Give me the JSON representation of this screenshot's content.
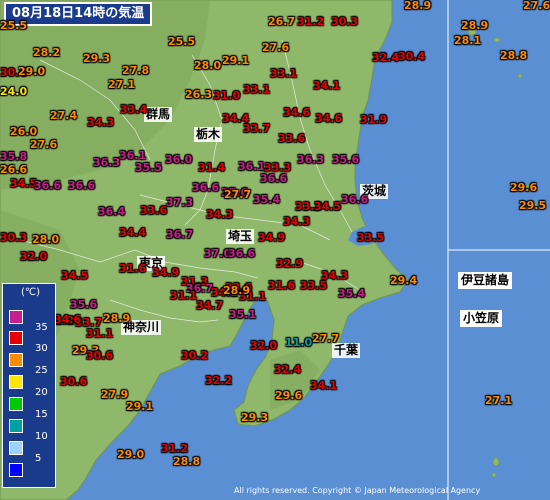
{
  "title": "08月18日14時の気温",
  "colors": {
    "temp_35": "#c81e8c",
    "temp_30": "#e60000",
    "temp_25": "#ff8c00",
    "temp_20": "#ffe600",
    "temp_15": "#00c800",
    "temp_10": "#00a0a0",
    "temp_5": "#a0d2ff",
    "temp_0": "#0000ff",
    "sea": "#5a8fd4",
    "land": "#8fb86a"
  },
  "legend": {
    "unit": "(℃)",
    "levels": [
      {
        "label": "35",
        "color": "#c81e8c"
      },
      {
        "label": "30",
        "color": "#e60000"
      },
      {
        "label": "25",
        "color": "#ff8c00"
      },
      {
        "label": "20",
        "color": "#ffe600"
      },
      {
        "label": "15",
        "color": "#00c800"
      },
      {
        "label": "10",
        "color": "#00a0a0"
      },
      {
        "label": "5",
        "color": "#a0d2ff"
      },
      {
        "label": "",
        "color": "#0000ff"
      }
    ]
  },
  "prefectures": {
    "gunma": "群馬",
    "tochigi": "栃木",
    "ibaraki": "茨城",
    "saitama": "埼玉",
    "tokyo": "東京",
    "kanagawa": "神奈川",
    "chiba": "千葉"
  },
  "islands": {
    "izu": "伊豆諸島",
    "ogasawara": "小笠原"
  },
  "copyright": "All rights reserved. Copyright © Japan Meteorological Agency",
  "stations": [
    "28.9",
    "27.6",
    "26.7",
    "31.2",
    "30.3",
    "28.9",
    "28.1",
    "25.5",
    "25.5",
    "28.2",
    "27.6",
    "28.8",
    "30.4",
    "32.4",
    "30.6",
    "29.3",
    "29.0",
    "28.0",
    "29.1",
    "27.8",
    "33.1",
    "27.1",
    "24.0",
    "26.3",
    "31.0",
    "33.1",
    "34.1",
    "33.4",
    "34.3",
    "34.4",
    "34.6",
    "34.6",
    "27.4",
    "31.9",
    "26.0",
    "33.7",
    "27.6",
    "33.6",
    "36.1",
    "35.8",
    "26.6",
    "35.6",
    "36.0",
    "36.3",
    "36.1",
    "36.3",
    "31.4",
    "33.3",
    "34.5",
    "36.6",
    "36.6",
    "35.5",
    "36.6",
    "36.6",
    "35.6",
    "27.7",
    "29.6",
    "29.5",
    "36.4",
    "33.6",
    "33.3",
    "35.4",
    "37.3",
    "36.6",
    "34.3",
    "34.5",
    "34.3",
    "30.3",
    "28.0",
    "34.4",
    "36.7",
    "34.9",
    "33.5",
    "37.0",
    "36.6",
    "32.0",
    "31.6",
    "34.9",
    "32.9",
    "34.3",
    "29.4",
    "34.5",
    "31.3",
    "33.6",
    "35.4",
    "31.6",
    "31.1",
    "35.6",
    "36.7",
    "33.5",
    "34.2",
    "35.2",
    "31.1",
    "28.9",
    "31.2",
    "33.7",
    "28.9",
    "34.7",
    "34.6",
    "35.1",
    "11.0",
    "27.7",
    "29.3",
    "30.6",
    "31.1",
    "32.0",
    "30.2",
    "32.4",
    "30.6",
    "27.9",
    "32.2",
    "34.1",
    "29.6",
    "29.1",
    "29.3",
    "27.1",
    "31.2",
    "28.8",
    "29.0"
  ]
}
